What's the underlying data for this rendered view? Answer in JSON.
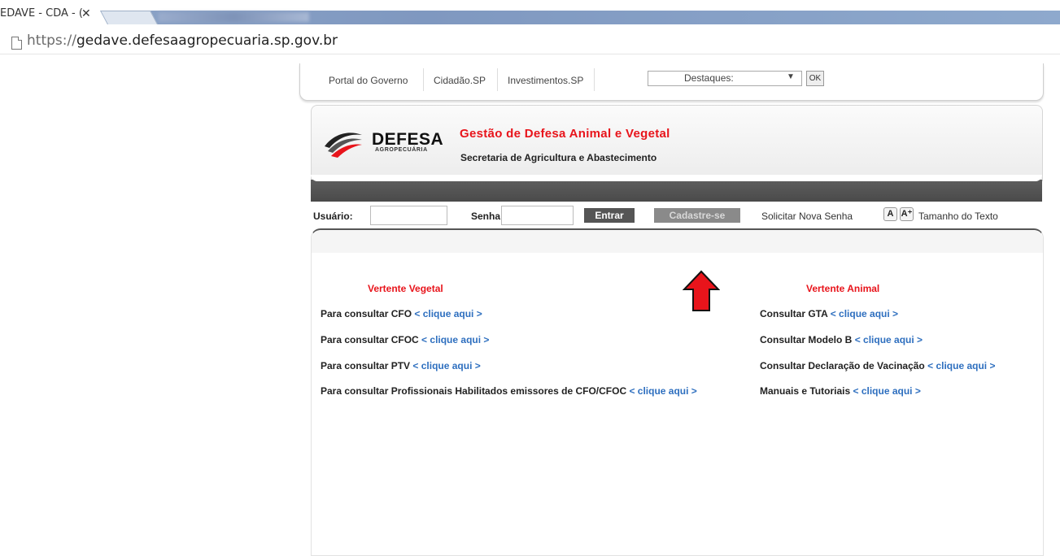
{
  "browser": {
    "tab_title": "EDAVE - CDA - (",
    "tab_close": "✕",
    "url_scheme": "https://",
    "url_host": "gedave.defesaagropecuaria.sp.gov.br"
  },
  "govbar": {
    "links": [
      "Portal do Governo",
      "Cidadão.SP",
      "Investimentos.SP"
    ],
    "select_label": "Destaques:",
    "select_arrow": "▼",
    "ok_label": "OK"
  },
  "header": {
    "logo_main": "DEFESA",
    "logo_sub": "AGROPECUÁRIA",
    "title": "Gestão de Defesa Animal e Vegetal",
    "subtitle": "Secretaria de Agricultura e Abastecimento"
  },
  "login": {
    "user_label": "Usuário:",
    "password_label": "Senha:",
    "enter_label": "Entrar",
    "register_label": "Cadastre-se",
    "new_password_label": "Solicitar Nova Senha",
    "font_small": "A",
    "font_large": "A⁺",
    "text_size_label": "Tamanho do Texto"
  },
  "vegetal": {
    "heading": "Vertente Vegetal",
    "items": [
      {
        "text": "Para consultar CFO",
        "link": "< clique aqui >"
      },
      {
        "text": "Para consultar CFOC",
        "link": "< clique aqui >"
      },
      {
        "text": "Para consultar PTV",
        "link": "< clique aqui >"
      },
      {
        "text": "Para consultar Profissionais Habilitados emissores de CFO/CFOC",
        "link": "< clique aqui >"
      }
    ]
  },
  "animal": {
    "heading": "Vertente Animal",
    "items": [
      {
        "text": "Consultar GTA",
        "link": "< clique aqui >"
      },
      {
        "text": "Consultar Modelo B",
        "link": "< clique aqui >"
      },
      {
        "text": "Consultar Declaração de Vacinação",
        "link": "< clique aqui >"
      },
      {
        "text": "Manuais e Tutoriais",
        "link": "< clique aqui >"
      }
    ]
  },
  "colors": {
    "accent_red": "#e8141b",
    "link_blue": "#2e6fbf",
    "dark_band": "#4a4a4a"
  }
}
